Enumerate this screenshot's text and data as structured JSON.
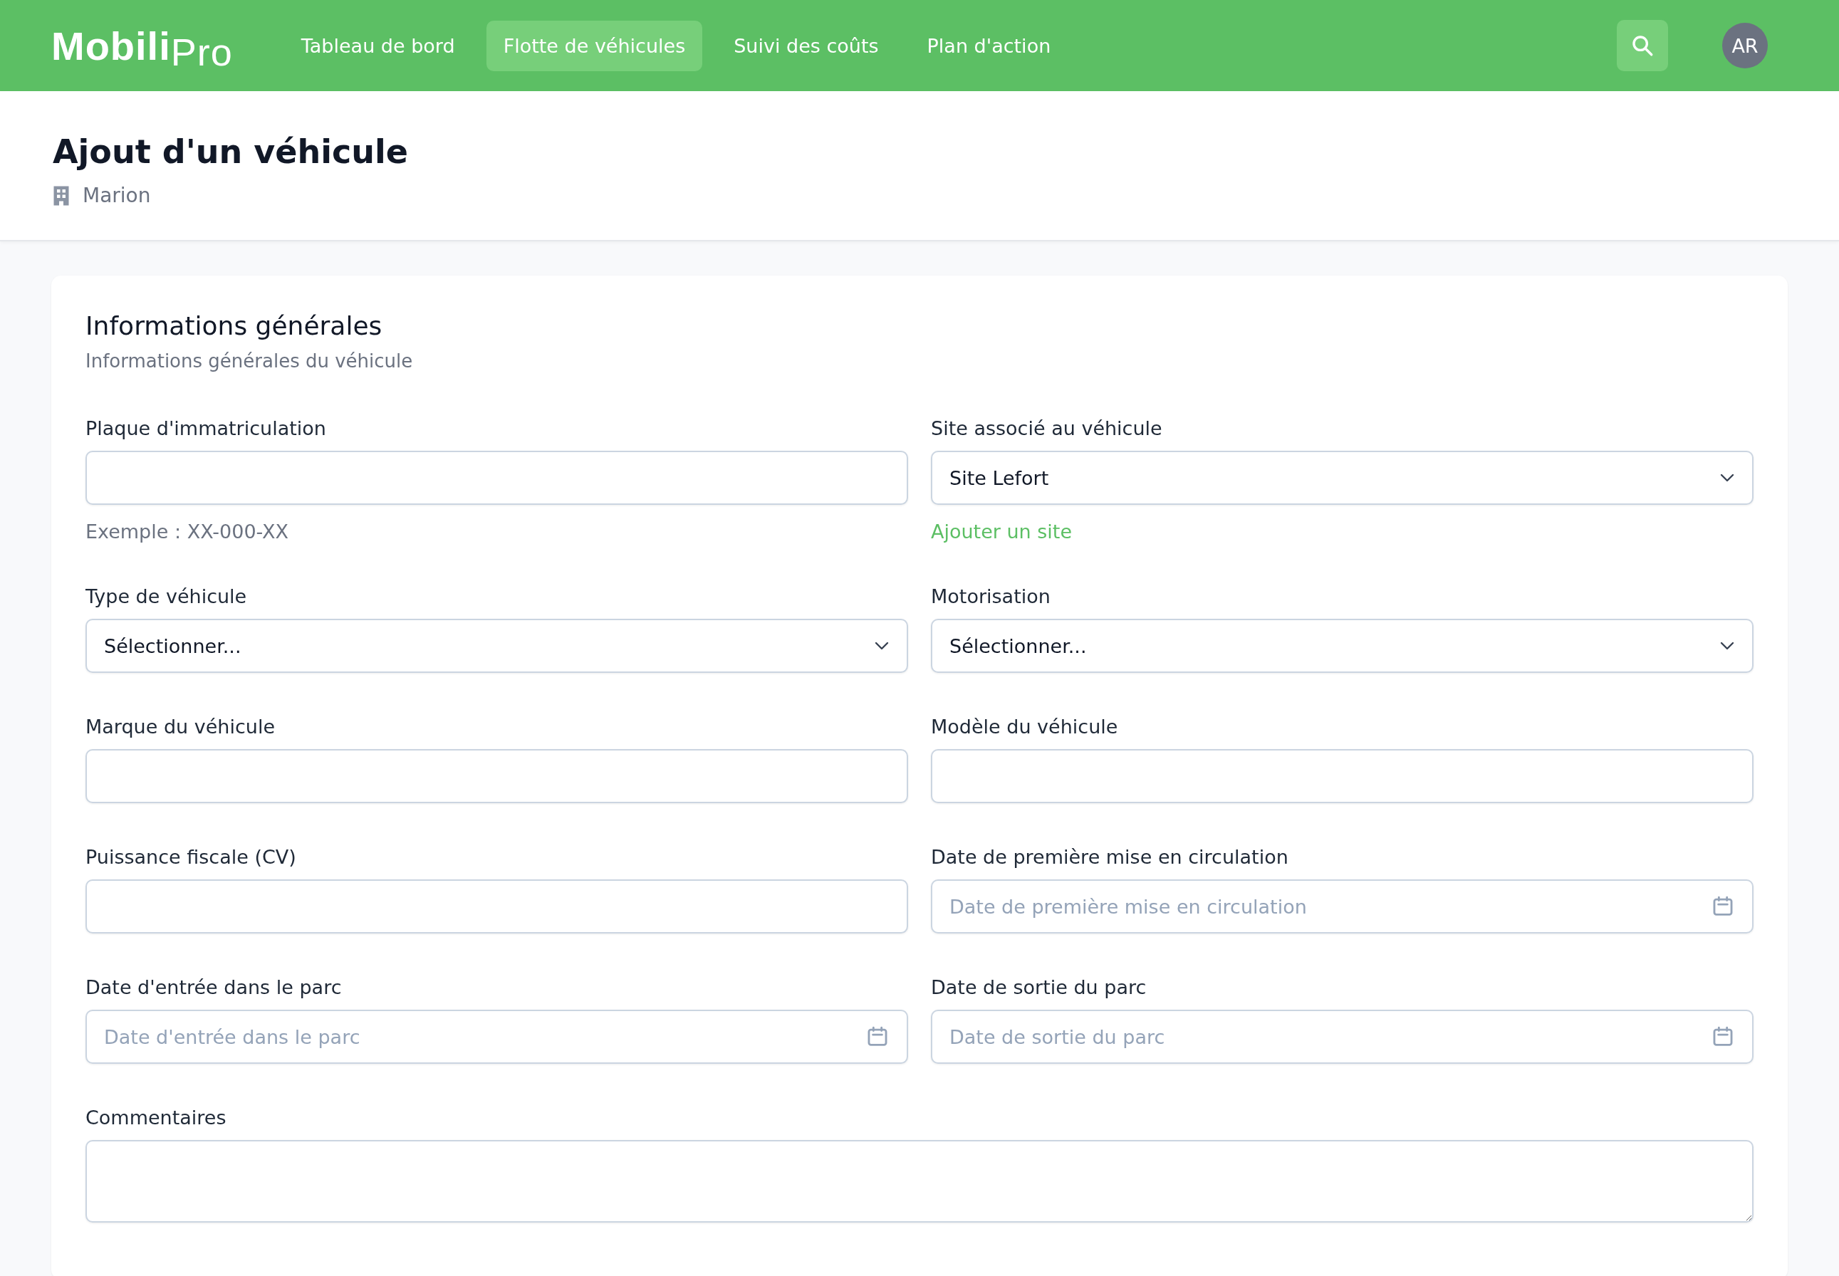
{
  "header": {
    "logo": {
      "main": "Mobili",
      "accent": "Pro"
    },
    "nav": [
      {
        "label": "Tableau de bord",
        "selected": false
      },
      {
        "label": "Flotte de véhicules",
        "selected": true
      },
      {
        "label": "Suivi des coûts",
        "selected": false
      },
      {
        "label": "Plan d'action",
        "selected": false
      }
    ],
    "avatar": "AR"
  },
  "page": {
    "title": "Ajout d'un véhicule",
    "site": "Marion"
  },
  "section": {
    "title": "Informations générales",
    "subtitle": "Informations générales du véhicule",
    "fields": [
      {
        "kind": "text",
        "label": "Plaque d'immatriculation",
        "hint": "Exemple : XX-000-XX"
      },
      {
        "kind": "select",
        "label": "Site associé au véhicule",
        "value": "Site Lefort",
        "link": "Ajouter un site"
      },
      {
        "kind": "select",
        "label": "Type de véhicule",
        "value": "Sélectionner..."
      },
      {
        "kind": "select",
        "label": "Motorisation",
        "value": "Sélectionner..."
      },
      {
        "kind": "text",
        "label": "Marque du véhicule"
      },
      {
        "kind": "text",
        "label": "Modèle du véhicule"
      },
      {
        "kind": "text",
        "label": "Puissance fiscale (CV)"
      },
      {
        "kind": "date",
        "label": "Date de première mise en circulation",
        "placeholder": "Date de première mise en circulation"
      },
      {
        "kind": "date",
        "label": "Date d'entrée dans le parc",
        "placeholder": "Date d'entrée dans le parc"
      },
      {
        "kind": "date",
        "label": "Date de sortie du parc",
        "placeholder": "Date de sortie du parc"
      },
      {
        "kind": "textarea",
        "label": "Commentaires"
      }
    ]
  }
}
